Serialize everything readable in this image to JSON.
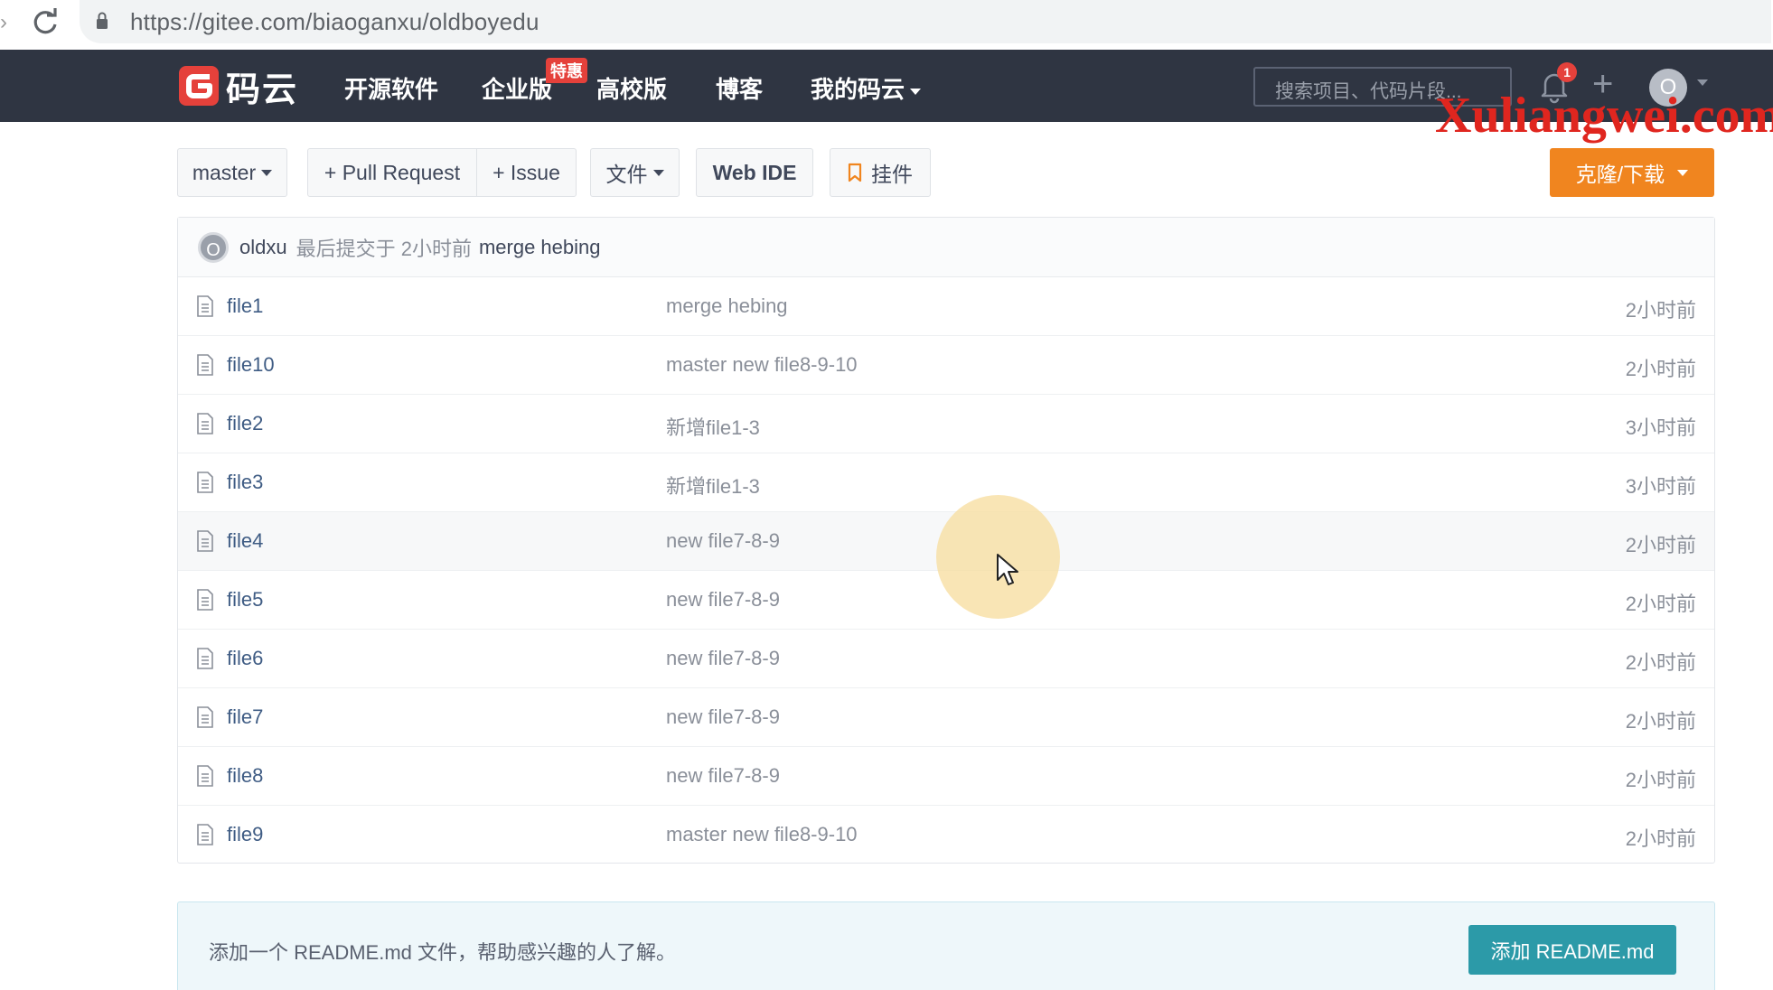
{
  "browser": {
    "url": "https://gitee.com/biaoganxu/oldboyedu"
  },
  "header": {
    "logo_text": "码云",
    "nav": [
      "开源软件",
      "企业版",
      "高校版",
      "博客",
      "我的码云"
    ],
    "enterprise_badge": "特惠",
    "search_placeholder": "搜索项目、代码片段...",
    "notification_count": "1",
    "avatar_letter": "O",
    "watermark": "Xuliangwei.com"
  },
  "toolbar": {
    "branch": "master",
    "pull_request": "+ Pull Request",
    "issue": "+ Issue",
    "file": "文件",
    "web_ide": "Web IDE",
    "plugin": "挂件",
    "clone": "克隆/下载"
  },
  "latest_commit": {
    "avatar_letter": "O",
    "author": "oldxu",
    "meta": "最后提交于 2小时前",
    "message": "merge hebing"
  },
  "files": [
    {
      "name": "file1",
      "commit": "merge hebing",
      "time": "2小时前"
    },
    {
      "name": "file10",
      "commit": "master new file8-9-10",
      "time": "2小时前"
    },
    {
      "name": "file2",
      "commit": "新增file1-3",
      "time": "3小时前"
    },
    {
      "name": "file3",
      "commit": "新增file1-3",
      "time": "3小时前"
    },
    {
      "name": "file4",
      "commit": "new file7-8-9",
      "time": "2小时前"
    },
    {
      "name": "file5",
      "commit": "new file7-8-9",
      "time": "2小时前"
    },
    {
      "name": "file6",
      "commit": "new file7-8-9",
      "time": "2小时前"
    },
    {
      "name": "file7",
      "commit": "new file7-8-9",
      "time": "2小时前"
    },
    {
      "name": "file8",
      "commit": "new file7-8-9",
      "time": "2小时前"
    },
    {
      "name": "file9",
      "commit": "master new file8-9-10",
      "time": "2小时前"
    }
  ],
  "readme": {
    "text": "添加一个 README.md 文件，帮助感兴趣的人了解。",
    "button": "添加 README.md"
  },
  "colors": {
    "header_bg": "#2f3542",
    "brand_red": "#e5413b",
    "clone_orange": "#f0851f",
    "readme_button": "#2c9aa8"
  }
}
